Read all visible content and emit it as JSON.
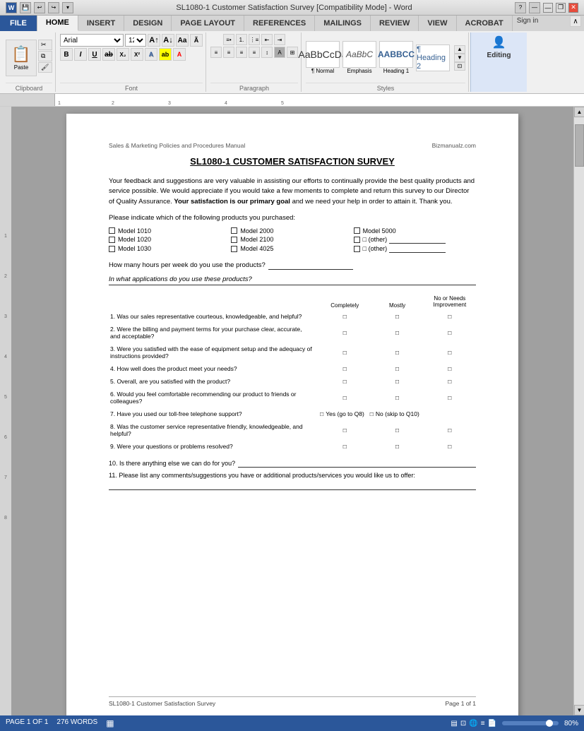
{
  "titlebar": {
    "title": "SL1080-1 Customer Satisfaction Survey [Compatibility Mode] - Word",
    "help_icon": "?",
    "restore_icon": "❐",
    "minimize_icon": "—",
    "close_icon": "✕",
    "sign_in": "Sign in"
  },
  "ribbon": {
    "tabs": [
      "FILE",
      "HOME",
      "INSERT",
      "DESIGN",
      "PAGE LAYOUT",
      "REFERENCES",
      "MAILINGS",
      "REVIEW",
      "VIEW",
      "ACROBAT"
    ],
    "active_tab": "HOME",
    "groups": {
      "clipboard": {
        "label": "Clipboard",
        "paste": "Paste",
        "cut": "Cut",
        "copy": "Copy",
        "format_painter": "Format Painter"
      },
      "font": {
        "label": "Font",
        "font_name": "Arial",
        "font_size": "12",
        "bold": "B",
        "italic": "I",
        "underline": "U"
      },
      "paragraph": {
        "label": "Paragraph"
      },
      "styles": {
        "label": "Styles",
        "items": [
          {
            "name": "Emphasis",
            "preview_class": "emphasis"
          },
          {
            "name": "Heading 1",
            "preview_class": "heading1"
          },
          {
            "name": "Heading 2",
            "preview_class": "heading2"
          }
        ]
      },
      "editing": {
        "label": "Editing",
        "title": "Editing"
      }
    }
  },
  "document": {
    "header_left": "Sales & Marketing Policies and Procedures Manual",
    "header_right": "Bizmanualz.com",
    "title": "SL1080-1 CUSTOMER SATISFACTION SURVEY",
    "intro": "Your feedback and suggestions are very valuable in assisting our efforts to continually provide the best quality products and service possible.  We would appreciate if you would take a few moments to complete and return this survey to our Director of Quality Assurance.",
    "intro_bold": "Your satisfaction is our primary goal",
    "intro_end": "and we need your help in order to attain it.  Thank you.",
    "products_prompt": "Please indicate which of the following products you purchased:",
    "products": [
      "Model 1010",
      "Model 2000",
      "Model 5000",
      "Model 1020",
      "Model 2100",
      "☐ (other) ___________",
      "Model 1030",
      "Model 4025",
      "☐ (other) ___________"
    ],
    "hours_question": "How many hours per week do you use the products?",
    "applications_question": "In what applications do you use these products?",
    "table_headers": {
      "question": "",
      "completely": "Completely",
      "mostly": "Mostly",
      "no_or_needs": "No or Needs Improvement"
    },
    "questions": [
      {
        "num": "1.",
        "text": "Was our sales representative courteous, knowledgeable, and helpful?"
      },
      {
        "num": "2.",
        "text": "Were the billing and payment terms for your purchase clear, accurate, and acceptable?"
      },
      {
        "num": "3.",
        "text": "Were you satisfied with the ease of equipment setup and the adequacy of instructions provided?"
      },
      {
        "num": "4.",
        "text": "How well does the product meet your needs?"
      },
      {
        "num": "5.",
        "text": "Overall, are you satisfied with the product?"
      },
      {
        "num": "6.",
        "text": "Would you feel comfortable recommending our product to friends or colleagues?"
      },
      {
        "num": "8.",
        "text": "Was the customer service representative friendly, knowledgeable, and helpful?"
      },
      {
        "num": "9.",
        "text": "Were your questions or problems resolved?"
      }
    ],
    "q7_text": "7. Have you used our toll-free telephone support?",
    "q7_yes": "☐ Yes (go to Q8)",
    "q7_no": "☐ No (skip to Q10)",
    "q10_text": "10. Is there anything else we can do for you?",
    "q11_text": "11. Please list any comments/suggestions you have or additional products/services you would like us to offer:",
    "footer_left": "SL1080-1 Customer Satisfaction Survey",
    "footer_right": "Page 1 of 1"
  },
  "status_bar": {
    "page_info": "PAGE 1 OF 1",
    "words": "276 WORDS",
    "zoom": "80%",
    "layout_icon": "▦",
    "view_icon": "▤"
  }
}
